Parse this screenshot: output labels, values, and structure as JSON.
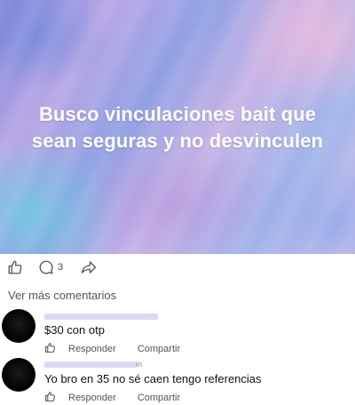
{
  "banner": {
    "line1": "Busco vinculaciones bait que",
    "line2": "sean seguras y no desvinculen"
  },
  "actions": {
    "comment_count": "3"
  },
  "more_comments": "Ver más comentarios",
  "comments": [
    {
      "text": "$30 con otp",
      "reply": "Responder",
      "share": "Compartir"
    },
    {
      "text": "Yo bro en 35 no sé caen tengo referencias",
      "reply": "Responder",
      "share": "Compartir",
      "side_mark": "in"
    }
  ]
}
